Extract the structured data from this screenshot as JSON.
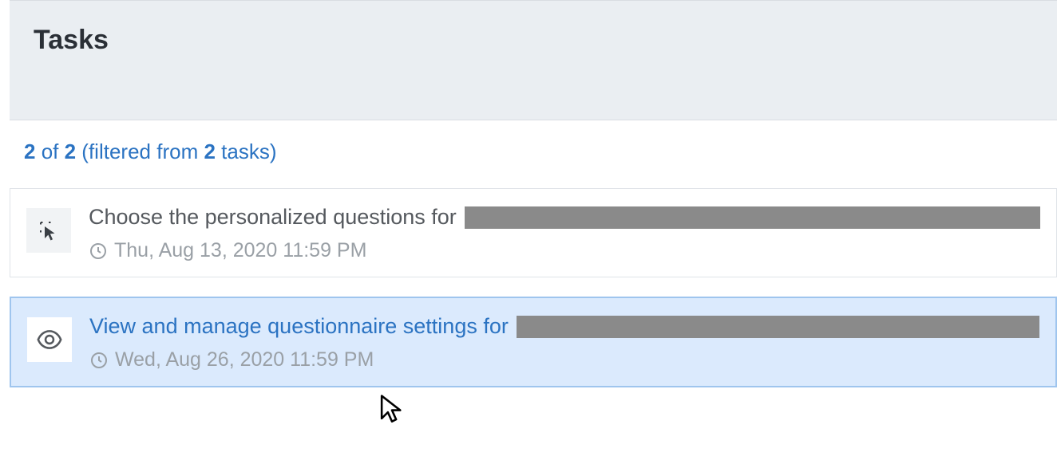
{
  "header": {
    "title": "Tasks"
  },
  "filter": {
    "count_shown": "2",
    "of_label": " of ",
    "count_total": "2",
    "filtered_prefix": " (filtered from ",
    "filtered_count": "2",
    "filtered_suffix": " tasks)"
  },
  "tasks": [
    {
      "title": "Choose the personalized questions for",
      "due": "Thu, Aug 13, 2020 11:59 PM",
      "icon": "select-cursor-icon",
      "selected": false
    },
    {
      "title": "View and manage questionnaire settings for",
      "due": "Wed, Aug 26, 2020 11:59 PM",
      "icon": "eye-icon",
      "selected": true
    }
  ]
}
